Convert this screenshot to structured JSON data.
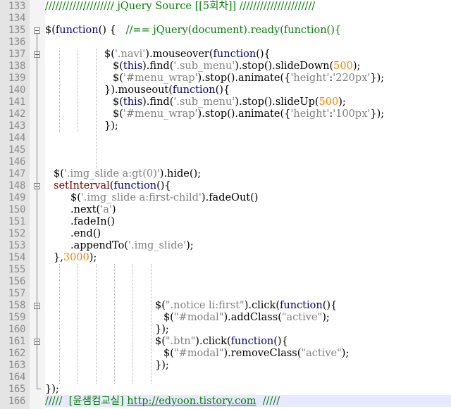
{
  "editor": {
    "lines": [
      {
        "n": "133",
        "t": "//////////////////// jQuery Source [[5회차]] //////////////////////"
      },
      {
        "n": "134",
        "t": ""
      },
      {
        "n": "135",
        "t": "$(function() {   //== jQuery(document).ready(function(){"
      },
      {
        "n": "136",
        "t": ""
      },
      {
        "n": "137",
        "t": "$('.navi').mouseover(function(){"
      },
      {
        "n": "138",
        "t": "$(this).find('.sub_menu').stop().slideDown(500);"
      },
      {
        "n": "139",
        "t": "$('#menu_wrap').stop().animate({'height':'220px'});"
      },
      {
        "n": "140",
        "t": "}).mouseout(function(){"
      },
      {
        "n": "141",
        "t": "$(this).find('.sub_menu').stop().slideUp(500);"
      },
      {
        "n": "142",
        "t": "$('#menu_wrap').stop().animate({'height':'100px'});"
      },
      {
        "n": "143",
        "t": "});"
      },
      {
        "n": "144",
        "t": ""
      },
      {
        "n": "145",
        "t": ""
      },
      {
        "n": "146",
        "t": ""
      },
      {
        "n": "147",
        "t": "$('.img_slide a:gt(0)').hide();"
      },
      {
        "n": "148",
        "t": "setInterval(function(){"
      },
      {
        "n": "149",
        "t": "$('.img_slide a:first-child').fadeOut()"
      },
      {
        "n": "150",
        "t": ".next('a')"
      },
      {
        "n": "151",
        "t": ".fadeIn()"
      },
      {
        "n": "152",
        "t": ".end()"
      },
      {
        "n": "153",
        "t": ".appendTo('.img_slide');"
      },
      {
        "n": "154",
        "t": "},3000);"
      },
      {
        "n": "155",
        "t": ""
      },
      {
        "n": "156",
        "t": ""
      },
      {
        "n": "157",
        "t": ""
      },
      {
        "n": "158",
        "t": "$(\".notice li:first\").click(function(){"
      },
      {
        "n": "159",
        "t": "$(\"#modal\").addClass(\"active\");"
      },
      {
        "n": "160",
        "t": "});"
      },
      {
        "n": "161",
        "t": "$(\".btn\").click(function(){"
      },
      {
        "n": "162",
        "t": "$(\"#modal\").removeClass(\"active\");"
      },
      {
        "n": "163",
        "t": "});"
      },
      {
        "n": "164",
        "t": ""
      },
      {
        "n": "165",
        "t": "});"
      },
      {
        "n": "166",
        "t": "/////  [윤샘컴교실] http://edyoon.tistory.com  /////"
      }
    ]
  },
  "colors": {
    "keyword": "#000080",
    "string": "#808080",
    "number": "#ff8000",
    "comment": "#008000",
    "gutter": "#e4e4e4",
    "current_line": "#e8e8ff"
  },
  "icons": {
    "fold_marker": "fold-collapse-icon"
  }
}
